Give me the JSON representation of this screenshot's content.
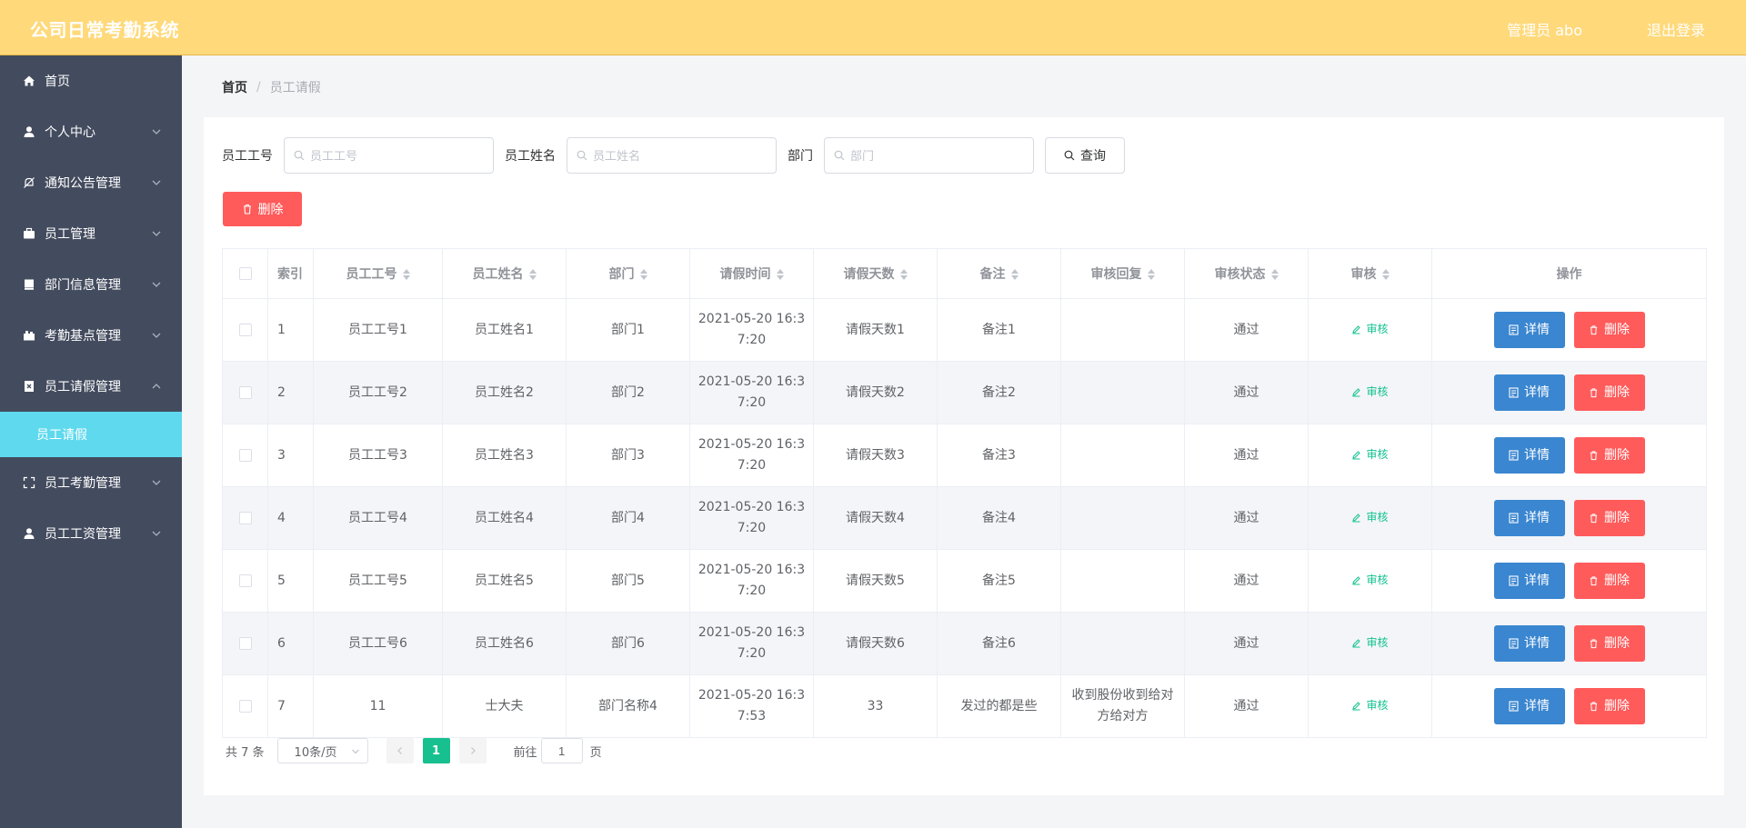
{
  "header": {
    "app_title": "公司日常考勤系统",
    "user_label": "管理员 abo",
    "logout_label": "退出登录"
  },
  "sidebar": {
    "items": [
      {
        "label": "首页",
        "icon": "home-icon",
        "expandable": false
      },
      {
        "label": "个人中心",
        "icon": "user-icon",
        "expandable": true
      },
      {
        "label": "通知公告管理",
        "icon": "bell-off-icon",
        "expandable": true
      },
      {
        "label": "员工管理",
        "icon": "briefcase-icon",
        "expandable": true
      },
      {
        "label": "部门信息管理",
        "icon": "notebook-icon",
        "expandable": true
      },
      {
        "label": "考勤基点管理",
        "icon": "suitcase-icon",
        "expandable": true
      },
      {
        "label": "员工请假管理",
        "icon": "document-x-icon",
        "expandable": true,
        "expanded": true
      },
      {
        "label": "员工考勤管理",
        "icon": "fullscreen-icon",
        "expandable": true
      },
      {
        "label": "员工工资管理",
        "icon": "user-icon",
        "expandable": true
      }
    ],
    "active_sub": "员工请假"
  },
  "breadcrumb": {
    "home": "首页",
    "sep": "/",
    "current": "员工请假"
  },
  "search": {
    "employee_no_label": "员工工号",
    "employee_no_placeholder": "员工工号",
    "employee_name_label": "员工姓名",
    "employee_name_placeholder": "员工姓名",
    "dept_label": "部门",
    "dept_placeholder": "部门",
    "query_label": "查询"
  },
  "toolbar": {
    "delete_label": "删除"
  },
  "table": {
    "columns": [
      "索引",
      "员工工号",
      "员工姓名",
      "部门",
      "请假时间",
      "请假天数",
      "备注",
      "审核回复",
      "审核状态",
      "审核",
      "操作"
    ],
    "rows": [
      {
        "idx": "1",
        "no": "员工工号1",
        "name": "员工姓名1",
        "dept": "部门1",
        "time_a": "2021-05-20 16:3",
        "time_b": "7:20",
        "days": "请假天数1",
        "remark": "备注1",
        "reply_a": "",
        "reply_b": "",
        "status": "通过"
      },
      {
        "idx": "2",
        "no": "员工工号2",
        "name": "员工姓名2",
        "dept": "部门2",
        "time_a": "2021-05-20 16:3",
        "time_b": "7:20",
        "days": "请假天数2",
        "remark": "备注2",
        "reply_a": "",
        "reply_b": "",
        "status": "通过"
      },
      {
        "idx": "3",
        "no": "员工工号3",
        "name": "员工姓名3",
        "dept": "部门3",
        "time_a": "2021-05-20 16:3",
        "time_b": "7:20",
        "days": "请假天数3",
        "remark": "备注3",
        "reply_a": "",
        "reply_b": "",
        "status": "通过"
      },
      {
        "idx": "4",
        "no": "员工工号4",
        "name": "员工姓名4",
        "dept": "部门4",
        "time_a": "2021-05-20 16:3",
        "time_b": "7:20",
        "days": "请假天数4",
        "remark": "备注4",
        "reply_a": "",
        "reply_b": "",
        "status": "通过"
      },
      {
        "idx": "5",
        "no": "员工工号5",
        "name": "员工姓名5",
        "dept": "部门5",
        "time_a": "2021-05-20 16:3",
        "time_b": "7:20",
        "days": "请假天数5",
        "remark": "备注5",
        "reply_a": "",
        "reply_b": "",
        "status": "通过"
      },
      {
        "idx": "6",
        "no": "员工工号6",
        "name": "员工姓名6",
        "dept": "部门6",
        "time_a": "2021-05-20 16:3",
        "time_b": "7:20",
        "days": "请假天数6",
        "remark": "备注6",
        "reply_a": "",
        "reply_b": "",
        "status": "通过"
      },
      {
        "idx": "7",
        "no": "11",
        "name": "士大夫",
        "dept": "部门名称4",
        "time_a": "2021-05-20 16:3",
        "time_b": "7:53",
        "days": "33",
        "remark": "发过的都是些",
        "reply_a": "收到股份收到给对",
        "reply_b": "方给对方",
        "status": "通过"
      }
    ],
    "audit_label": "审核",
    "detail_label": "详情",
    "delete_label": "删除"
  },
  "pager": {
    "total": "共 7 条",
    "page_size": "10条/页",
    "current_page": "1",
    "goto_label": "前往",
    "goto_value": "1",
    "unit": "页"
  },
  "colors": {
    "header_bg": "#ffd97a",
    "sidebar_bg": "#434b5e",
    "active_sub_bg": "#5fd9ee",
    "danger": "#ff5b5b",
    "primary": "#3a86d0",
    "success": "#19c08f"
  }
}
